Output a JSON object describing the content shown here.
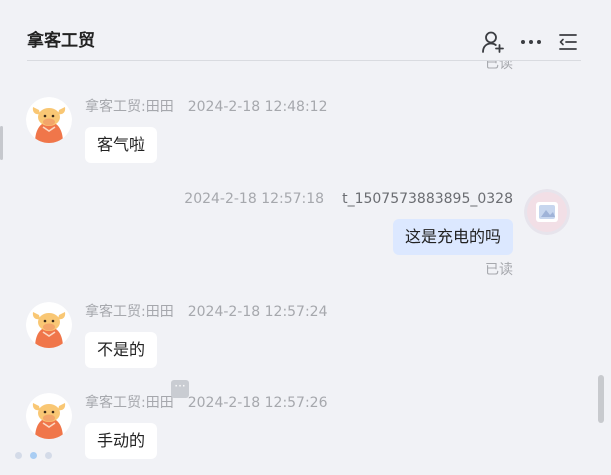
{
  "header": {
    "title": "拿客工贸",
    "icons": {
      "add_user": "add-user-icon",
      "more": "more-horizontal-icon",
      "menu": "list-collapse-icon"
    }
  },
  "colors": {
    "background": "#f1f2f6",
    "own_bubble": "#dce8ff",
    "other_bubble": "#ffffff",
    "meta_text": "#a6a8ad",
    "avatar_orange": "#f0764a",
    "avatar_yellow": "#f9c774"
  },
  "top_read_status": "已读",
  "messages": [
    {
      "side": "left",
      "sender": "拿客工贸:田田",
      "time": "2024-2-18 12:48:12",
      "text": "客气啦"
    },
    {
      "side": "right",
      "sender": "t_1507573883895_0328",
      "time": "2024-2-18 12:57:18",
      "text": "这是充电的吗",
      "status": "已读"
    },
    {
      "side": "left",
      "sender": "拿客工贸:田田",
      "time": "2024-2-18 12:57:24",
      "text": "不是的"
    },
    {
      "side": "left",
      "sender": "拿客工贸:田田",
      "time": "2024-2-18 12:57:26",
      "text": "手动的"
    }
  ],
  "more_chip": "···"
}
